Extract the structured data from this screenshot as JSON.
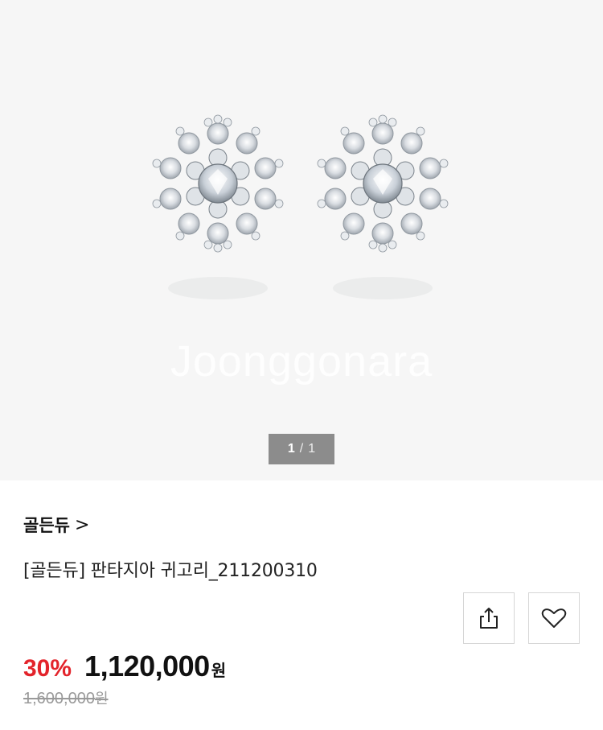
{
  "gallery": {
    "watermark": "Joonggonara",
    "pager": {
      "current": "1",
      "separator": "/",
      "total": "1"
    },
    "image": {
      "icon": "earrings-image"
    }
  },
  "product": {
    "brand": "골든듀",
    "brand_chevron": ">",
    "title": "[골든듀] 판타지아 귀고리_211200310",
    "discount": "30%",
    "price": "1,120,000",
    "price_unit": "원",
    "original_price": "1,600,000",
    "original_unit": "원"
  },
  "actions": {
    "share_icon": "share-icon",
    "wishlist_icon": "heart-icon"
  },
  "colors": {
    "gallery_bg": "#f6f6f6",
    "discount": "#e3242b",
    "pager_bg": "#8c8c8c"
  }
}
